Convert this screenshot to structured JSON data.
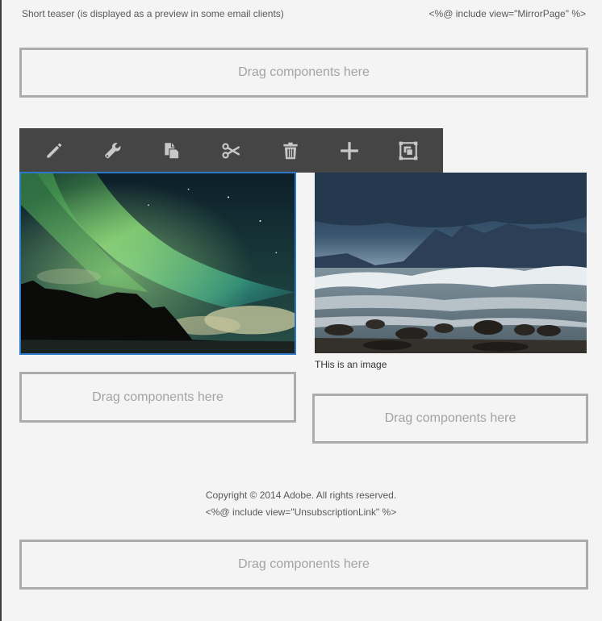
{
  "header": {
    "teaser": "Short teaser (is displayed as a preview in some email clients)",
    "mirror_page": "<%@ include view=\"MirrorPage\" %>"
  },
  "dropzones": {
    "label": "Drag components here"
  },
  "toolbar": {
    "icons": [
      "pencil-icon",
      "wrench-icon",
      "copy-icon",
      "scissors-icon",
      "trash-icon",
      "plus-icon",
      "layout-icon"
    ]
  },
  "images": {
    "left": {
      "subject": "northern lights over mountains",
      "selected": true
    },
    "right": {
      "subject": "stormy sea with mountains",
      "caption": "THis is an image"
    }
  },
  "footer": {
    "copyright": "Copyright © 2014 Adobe. All rights reserved.",
    "unsubscription": "<%@ include view=\"UnsubscriptionLink\" %>"
  },
  "colors": {
    "background": "#f4f4f4",
    "toolbar": "#454545",
    "selection": "#2d78c8",
    "dropzone_border": "#acacac"
  }
}
